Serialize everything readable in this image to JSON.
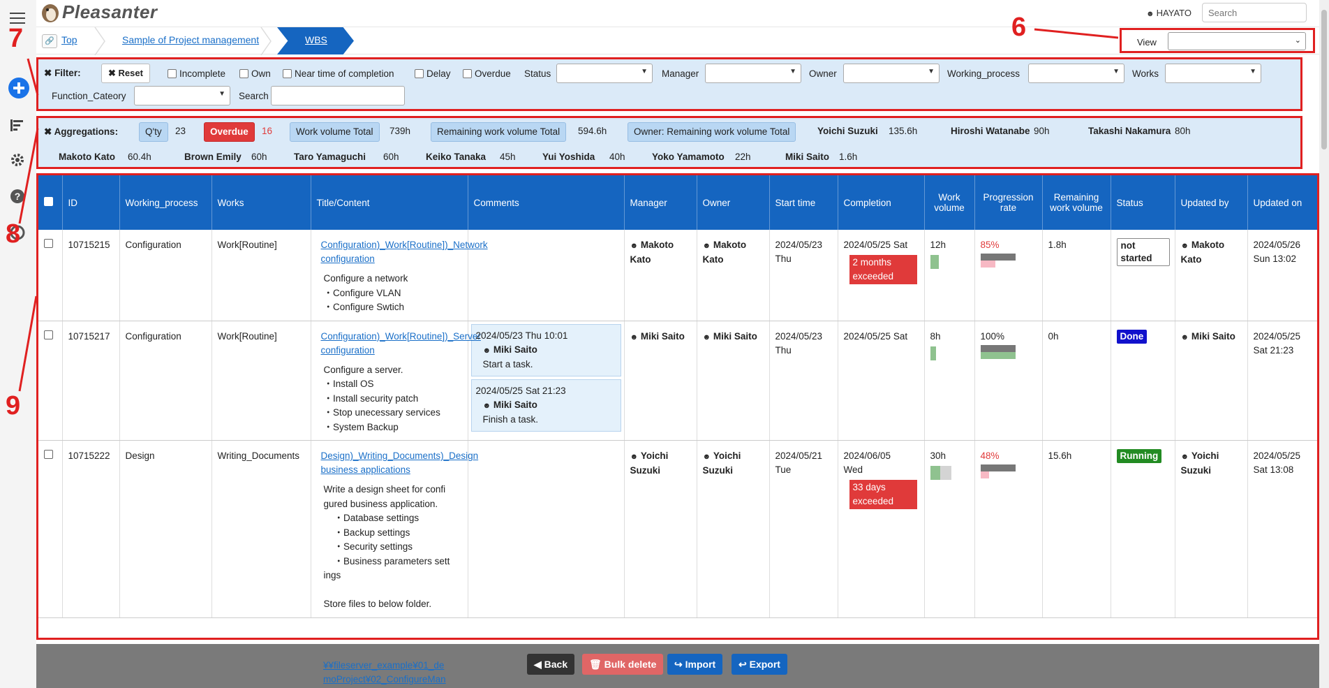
{
  "header": {
    "app_name": "Pleasanter",
    "user": "HAYATO",
    "search_placeholder": "Search"
  },
  "breadcrumb": [
    "Top",
    "Sample of Project management",
    "WBS"
  ],
  "view": {
    "label": "View",
    "value": ""
  },
  "filter": {
    "title": "Filter:",
    "reset": "Reset",
    "checkboxes": [
      "Incomplete",
      "Own",
      "Near time of completion",
      "Delay",
      "Overdue"
    ],
    "selects": [
      "Status",
      "Manager",
      "Owner",
      "Working_process",
      "Works",
      "Function_Cateory"
    ],
    "search_label": "Search"
  },
  "aggregations": {
    "title": "Aggregations:",
    "qty_label": "Q'ty",
    "qty_value": "23",
    "overdue_label": "Overdue",
    "overdue_value": "16",
    "work_volume_label": "Work volume Total",
    "work_volume_value": "739h",
    "remaining_label": "Remaining work volume Total",
    "remaining_value": "594.6h",
    "owner_label": "Owner: Remaining work volume Total",
    "owners": [
      {
        "name": "Yoichi Suzuki",
        "value": "135.6h"
      },
      {
        "name": "Hiroshi Watanabe",
        "value": "90h"
      },
      {
        "name": "Takashi Nakamura",
        "value": "80h"
      },
      {
        "name": "Makoto Kato",
        "value": "60.4h"
      },
      {
        "name": "Brown Emily",
        "value": "60h"
      },
      {
        "name": "Taro Yamaguchi",
        "value": "60h"
      },
      {
        "name": "Keiko Tanaka",
        "value": "45h"
      },
      {
        "name": "Yui Yoshida",
        "value": "40h"
      },
      {
        "name": "Yoko Yamamoto",
        "value": "22h"
      },
      {
        "name": "Miki Saito",
        "value": "1.6h"
      }
    ]
  },
  "table": {
    "headers": [
      "ID",
      "Working_process",
      "Works",
      "Title/Content",
      "Comments",
      "Manager",
      "Owner",
      "Start time",
      "Completion",
      "Work volume",
      "Progression rate",
      "Remaining work volume",
      "Status",
      "Updated by",
      "Updated on"
    ],
    "rows": [
      {
        "id": "10715215",
        "process": "Configuration",
        "works": "Work[Routine]",
        "title": "Configuration)_Work[Routine])_Network configuration",
        "body": "Configure a network\n・Configure VLAN\n・Configure Swtich",
        "comments": [],
        "manager": "Makoto Kato",
        "owner": "Makoto Kato",
        "start1": "2024/05/23",
        "start2": "Thu",
        "completion": "2024/05/25 Sat",
        "completion2": "",
        "exceeded": "2 months exceeded",
        "work_volume": "12h",
        "work_fill": 0.4,
        "progress": "85%",
        "progress_value": 0.85,
        "progress_red": true,
        "remaining": "1.8h",
        "status": "not started",
        "status_type": "ns",
        "updated_by": "Makoto Kato",
        "updated1": "2024/05/26",
        "updated2": "Sun 13:02"
      },
      {
        "id": "10715217",
        "process": "Configuration",
        "works": "Work[Routine]",
        "title": "Configuration)_Work[Routine])_Server configuration",
        "body": "Configure a server.\n・Install OS\n・Install security patch\n・Stop unecessary services\n・System Backup",
        "comments": [
          {
            "date": "2024/05/23 Thu 10:01",
            "user": "Miki Saito",
            "text": "Start a task."
          },
          {
            "date": "2024/05/25 Sat 21:23",
            "user": "Miki Saito",
            "text": "Finish a task."
          }
        ],
        "manager": "Miki Saito",
        "owner": "Miki Saito",
        "start1": "2024/05/23",
        "start2": "Thu",
        "completion": "2024/05/25 Sat",
        "completion2": "",
        "exceeded": "",
        "work_volume": "8h",
        "work_fill": 0.27,
        "progress": "100%",
        "progress_value": 1.0,
        "progress_red": false,
        "remaining": "0h",
        "status": "Done",
        "status_type": "done",
        "updated_by": "Miki Saito",
        "updated1": "2024/05/25",
        "updated2": "Sat 21:23"
      },
      {
        "id": "10715222",
        "process": "Design",
        "works": "Writing_Documents",
        "title": "Design)_Writing_Documents)_Design business applications",
        "body": "Write a design sheet for confi\ngured business application.\n    ・Database settings\n    ・Backup settings\n    ・Security settings\n    ・Business parameters sett\nings\n\nStore files to below folder.",
        "comments": [],
        "manager": "Yoichi Suzuki",
        "owner": "Yoichi Suzuki",
        "start1": "2024/05/21",
        "start2": "Tue",
        "completion": "2024/06/05",
        "completion2": "Wed",
        "exceeded": "33 days exceeded",
        "work_volume": "30h",
        "work_fill": 0.48,
        "progress": "48%",
        "progress_value": 0.48,
        "progress_red": true,
        "remaining": "15.6h",
        "status": "Running",
        "status_type": "run",
        "updated_by": "Yoichi Suzuki",
        "updated1": "2024/05/25",
        "updated2": "Sat 13:08"
      }
    ],
    "overflow_link": "¥¥fileserver_example¥01_de moProject¥02_ConfigureMan"
  },
  "bottom": {
    "back": "Back",
    "bulk_delete": "Bulk delete",
    "import": "Import",
    "export": "Export"
  },
  "annotations": [
    "6",
    "7",
    "8",
    "9"
  ]
}
